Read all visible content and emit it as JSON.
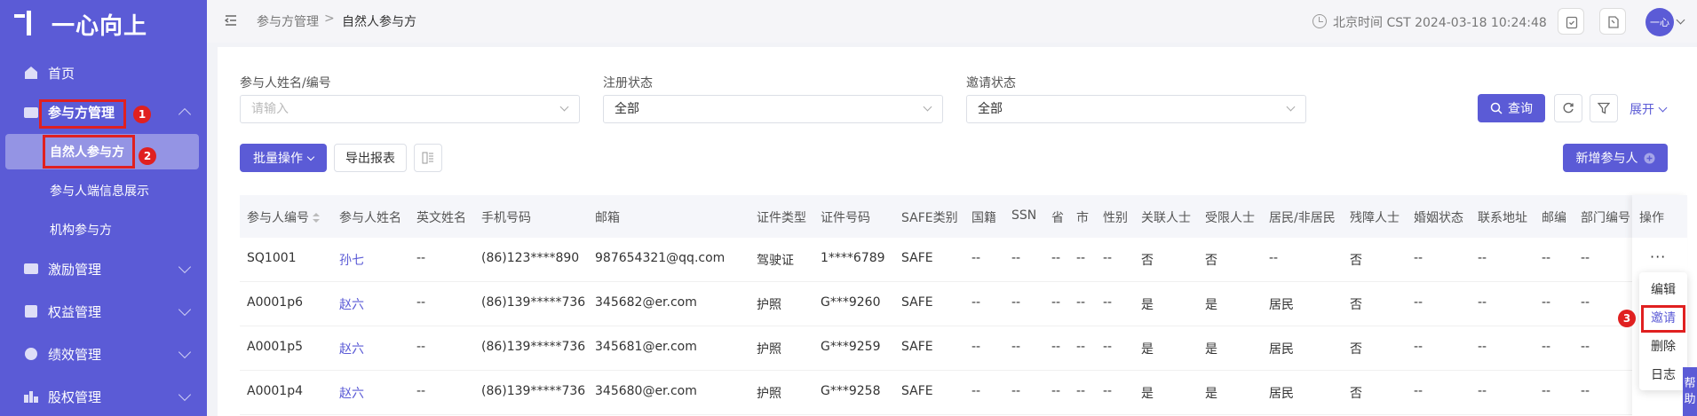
{
  "logo": {
    "text": "一心向上"
  },
  "sidebar": {
    "items": [
      {
        "label": "首页",
        "icon": "home-icon"
      },
      {
        "label": "参与方管理",
        "icon": "participant-icon"
      },
      {
        "label": "激励管理",
        "icon": "incentive-icon"
      },
      {
        "label": "权益管理",
        "icon": "equity-icon"
      },
      {
        "label": "绩效管理",
        "icon": "performance-icon"
      },
      {
        "label": "股权管理",
        "icon": "stock-icon"
      }
    ],
    "sub_items": [
      {
        "label": "自然人参与方"
      },
      {
        "label": "参与人端信息展示"
      },
      {
        "label": "机构参与方"
      }
    ]
  },
  "annotations": {
    "n1": "1",
    "n2": "2",
    "n3": "3"
  },
  "header": {
    "breadcrumb": [
      "参与方管理",
      "自然人参与方"
    ],
    "breadcrumb_sep": ">",
    "time": "北京时间 CST 2024-03-18 10:24:48",
    "avatar_text": "一心"
  },
  "filters": {
    "name": {
      "label": "参与人姓名/编号",
      "placeholder": "请输入"
    },
    "reg": {
      "label": "注册状态",
      "value": "全部"
    },
    "invite": {
      "label": "邀请状态",
      "value": "全部"
    },
    "query_label": "查询",
    "expand_label": "展开"
  },
  "toolbar": {
    "batch_label": "批量操作",
    "export_label": "导出报表",
    "add_label": "新增参与人"
  },
  "table": {
    "columns": [
      "参与人编号",
      "参与人姓名",
      "英文姓名",
      "手机号码",
      "邮箱",
      "证件类型",
      "证件号码",
      "SAFE类别",
      "国籍",
      "SSN",
      "省",
      "市",
      "性别",
      "关联人士",
      "受限人士",
      "居民/非居民",
      "残障人士",
      "婚姻状态",
      "联系地址",
      "邮编",
      "部门编号"
    ],
    "ops_header": "操作",
    "ops_more": "···",
    "rows": [
      [
        "SQ1001",
        "孙七",
        "--",
        "(86)123****890",
        "987654321@qq.com",
        "驾驶证",
        "1****6789",
        "SAFE",
        "--",
        "--",
        "--",
        "--",
        "--",
        "否",
        "否",
        "--",
        "否",
        "--",
        "--",
        "--",
        "--"
      ],
      [
        "A0001p6",
        "赵六",
        "--",
        "(86)139*****736",
        "345682@er.com",
        "护照",
        "G***9260",
        "SAFE",
        "--",
        "--",
        "--",
        "--",
        "--",
        "是",
        "是",
        "居民",
        "否",
        "--",
        "--",
        "--",
        "--"
      ],
      [
        "A0001p5",
        "赵六",
        "--",
        "(86)139*****736",
        "345681@er.com",
        "护照",
        "G***9259",
        "SAFE",
        "--",
        "--",
        "--",
        "--",
        "--",
        "是",
        "是",
        "居民",
        "否",
        "--",
        "--",
        "--",
        "--"
      ],
      [
        "A0001p4",
        "赵六",
        "--",
        "(86)139*****736",
        "345680@er.com",
        "护照",
        "G***9258",
        "SAFE",
        "--",
        "--",
        "--",
        "--",
        "--",
        "是",
        "是",
        "居民",
        "否",
        "--",
        "--",
        "--",
        "--"
      ]
    ]
  },
  "popup": {
    "items": [
      "编辑",
      "邀请",
      "删除",
      "日志"
    ]
  },
  "help": {
    "label": "帮助"
  },
  "colors": {
    "accent": "#5b5bd6",
    "annotation": "#e02020"
  }
}
